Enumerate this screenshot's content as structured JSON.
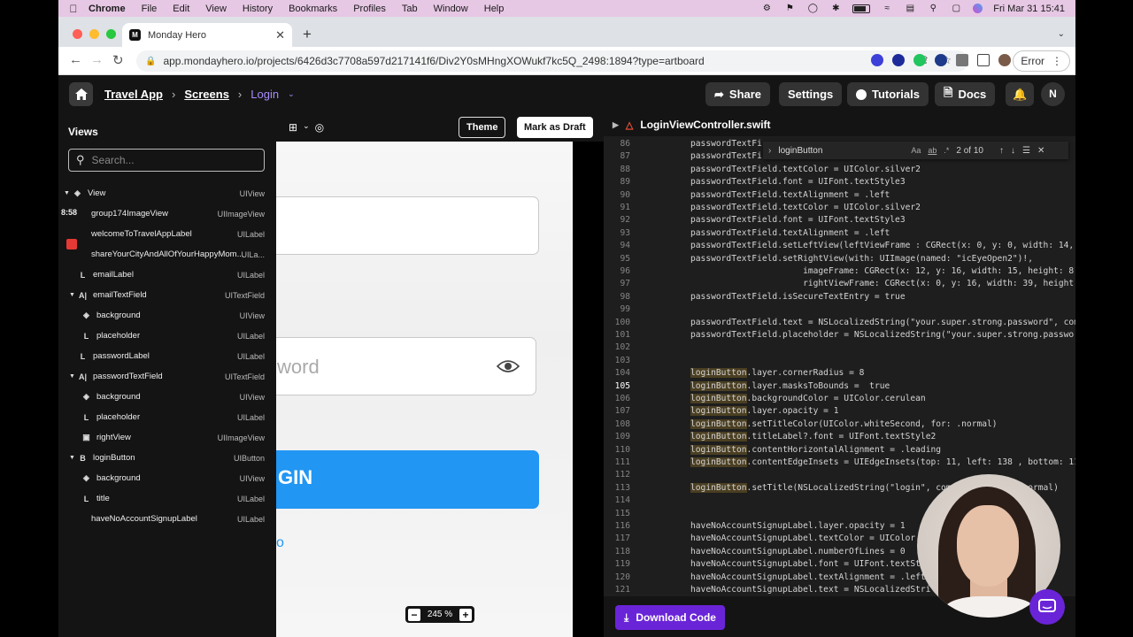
{
  "menubar": {
    "app": "Chrome",
    "items": [
      "File",
      "Edit",
      "View",
      "History",
      "Bookmarks",
      "Profiles",
      "Tab",
      "Window",
      "Help"
    ],
    "clock": "Fri Mar 31  15:41"
  },
  "browser": {
    "tab_title": "Monday Hero",
    "url": "app.mondayhero.io/projects/6426d3c7708a597d217141f6/Div2Y0sMHngXOWukf7kc5Q_2498:1894?type=artboard",
    "error_label": "Error"
  },
  "header": {
    "crumbs": [
      "Travel App",
      "Screens",
      "Login"
    ],
    "share": "Share",
    "settings": "Settings",
    "tutorials": "Tutorials",
    "docs": "Docs",
    "avatar": "N"
  },
  "sidebar": {
    "title": "Views",
    "search_placeholder": "Search...",
    "time_badge": "8:58",
    "rows": [
      {
        "name": "View",
        "type": "UIView"
      },
      {
        "name": "group174ImageView",
        "type": "UIImageView"
      },
      {
        "name": "welcomeToTravelAppLabel",
        "type": "UILabel"
      },
      {
        "name": "shareYourCityAndAllOfYourHappyMom...",
        "type": "UILa..."
      },
      {
        "name": "emailLabel",
        "type": "UILabel"
      },
      {
        "name": "emailTextField",
        "type": "UITextField"
      },
      {
        "name": "background",
        "type": "UIView"
      },
      {
        "name": "placeholder",
        "type": "UILabel"
      },
      {
        "name": "passwordLabel",
        "type": "UILabel"
      },
      {
        "name": "passwordTextField",
        "type": "UITextField"
      },
      {
        "name": "background",
        "type": "UIView"
      },
      {
        "name": "placeholder",
        "type": "UILabel"
      },
      {
        "name": "rightView",
        "type": "UIImageView"
      },
      {
        "name": "loginButton",
        "type": "UIButton"
      },
      {
        "name": "background",
        "type": "UIView"
      },
      {
        "name": "title",
        "type": "UILabel"
      },
      {
        "name": "haveNoAccountSignupLabel",
        "type": "UILabel"
      }
    ]
  },
  "canvas": {
    "theme": "Theme",
    "mark_draft": "Mark as Draft",
    "password_placeholder": "word",
    "login_text": "GIN",
    "link_char": "o",
    "zoom": "245 %",
    "zoom_minus": "−",
    "zoom_plus": "+"
  },
  "code": {
    "filename": "LoginViewController.swift",
    "find": {
      "query": "loginButton",
      "count": "2 of 10",
      "opts": [
        "Aa",
        "ab",
        ".*"
      ]
    },
    "current_line": 105,
    "lines": [
      {
        "n": "86",
        "t": "passwordTextFi"
      },
      {
        "n": "87",
        "t": "passwordTextFi"
      },
      {
        "n": "88",
        "t": "passwordTextField.textColor = UIColor.silver2"
      },
      {
        "n": "89",
        "t": "passwordTextField.font = UIFont.textStyle3"
      },
      {
        "n": "90",
        "t": "passwordTextField.textAlignment = .left"
      },
      {
        "n": "91",
        "t": "passwordTextField.textColor = UIColor.silver2"
      },
      {
        "n": "92",
        "t": "passwordTextField.font = UIFont.textStyle3"
      },
      {
        "n": "93",
        "t": "passwordTextField.textAlignment = .left"
      },
      {
        "n": "94",
        "t": "passwordTextField.setLeftView(leftViewFrame : CGRect(x: 0, y: 0, width: 14,"
      },
      {
        "n": "95",
        "t": "passwordTextField.setRightView(with: UIImage(named: \"icEyeOpen2\")!,"
      },
      {
        "n": "96",
        "t": "                      imageFrame: CGRect(x: 12, y: 16, width: 15, height: 8"
      },
      {
        "n": "97",
        "t": "                      rightViewFrame: CGRect(x: 0, y: 16, width: 39, height"
      },
      {
        "n": "98",
        "t": "passwordTextField.isSecureTextEntry = true"
      },
      {
        "n": "99",
        "t": ""
      },
      {
        "n": "100",
        "t": "passwordTextField.text = NSLocalizedString(\"your.super.strong.password\", com"
      },
      {
        "n": "101",
        "t": "passwordTextField.placeholder = NSLocalizedString(\"your.super.strong.passwo"
      },
      {
        "n": "102",
        "t": ""
      },
      {
        "n": "103",
        "t": ""
      },
      {
        "n": "104",
        "t": "loginButton.layer.cornerRadius = 8"
      },
      {
        "n": "105",
        "t": "loginButton.layer.masksToBounds =  true"
      },
      {
        "n": "106",
        "t": "loginButton.backgroundColor = UIColor.cerulean"
      },
      {
        "n": "107",
        "t": "loginButton.layer.opacity = 1"
      },
      {
        "n": "108",
        "t": "loginButton.setTitleColor(UIColor.whiteSecond, for: .normal)"
      },
      {
        "n": "109",
        "t": "loginButton.titleLabel?.font = UIFont.textStyle2"
      },
      {
        "n": "110",
        "t": "loginButton.contentHorizontalAlignment = .leading"
      },
      {
        "n": "111",
        "t": "loginButton.contentEdgeInsets = UIEdgeInsets(top: 11, left: 138 , bottom: 11"
      },
      {
        "n": "112",
        "t": ""
      },
      {
        "n": "113",
        "t": "loginButton.setTitle(NSLocalizedString(\"login\", comm            .normal)"
      },
      {
        "n": "114",
        "t": ""
      },
      {
        "n": "115",
        "t": ""
      },
      {
        "n": "116",
        "t": "haveNoAccountSignupLabel.layer.opacity = 1"
      },
      {
        "n": "117",
        "t": "haveNoAccountSignupLabel.textColor = UIColor."
      },
      {
        "n": "118",
        "t": "haveNoAccountSignupLabel.numberOfLines = 0"
      },
      {
        "n": "119",
        "t": "haveNoAccountSignupLabel.font = UIFont.textSt"
      },
      {
        "n": "120",
        "t": "haveNoAccountSignupLabel.textAlignment = .left"
      },
      {
        "n": "121",
        "t": "haveNoAccountSignupLabel.text = NSLocalizedStri         nup\","
      }
    ],
    "download": "Download Code"
  },
  "colors": {
    "accent_purple": "#6a24d8",
    "login_blue": "#2196f3",
    "breadcrumb_current": "#a78bfa"
  }
}
